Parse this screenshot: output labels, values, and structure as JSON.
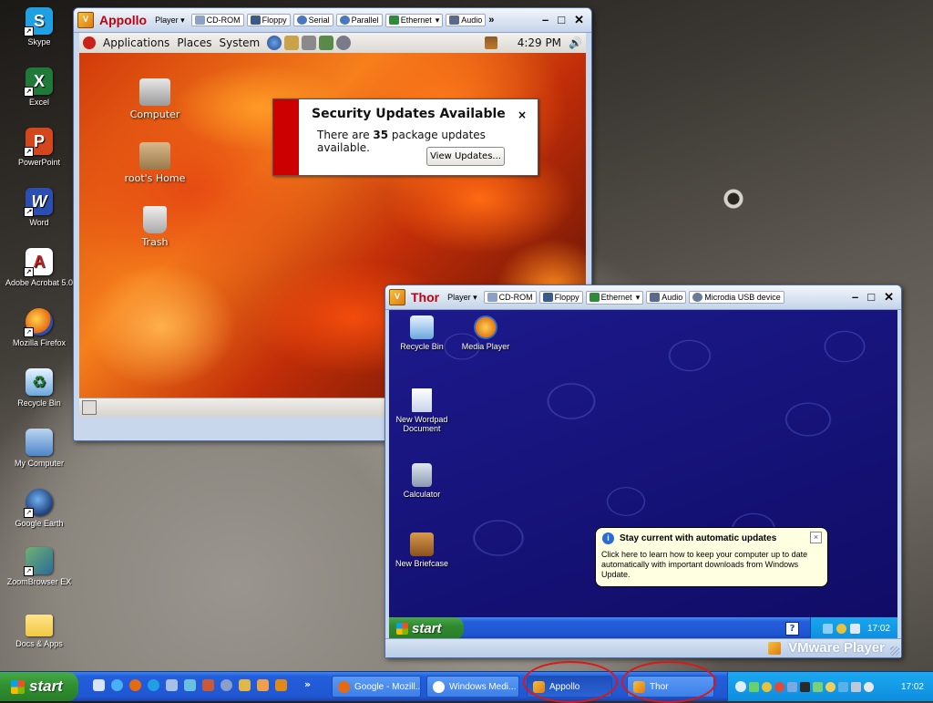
{
  "host_desktop": {
    "icons": [
      {
        "label": "Skype",
        "icon": "skype-icon",
        "color": "#1fa0e3",
        "glyph": "S"
      },
      {
        "label": "Excel",
        "icon": "excel-icon",
        "color": "#1f7a3a",
        "glyph": "X"
      },
      {
        "label": "PowerPoint",
        "icon": "powerpoint-icon",
        "color": "#d4461b",
        "glyph": "P"
      },
      {
        "label": "Word",
        "icon": "word-icon",
        "color": "#2a4fb0",
        "glyph": "W"
      },
      {
        "label": "Adobe Acrobat 5.0",
        "icon": "acrobat-icon",
        "color": "#c81f1f",
        "glyph": "A"
      },
      {
        "label": "Mozilla Firefox",
        "icon": "firefox-icon",
        "color": "#e56a12",
        "glyph": "F"
      },
      {
        "label": "Recycle Bin",
        "icon": "recycle-bin-icon",
        "color": "#5aa0d8",
        "glyph": "♻"
      },
      {
        "label": "My Computer",
        "icon": "my-computer-icon",
        "color": "#4d86c9",
        "glyph": "▣"
      },
      {
        "label": "Google Earth",
        "icon": "google-earth-icon",
        "color": "#20407a",
        "glyph": "◐"
      },
      {
        "label": "ZoomBrowser EX",
        "icon": "zoombrowser-icon",
        "color": "#3b7a3f",
        "glyph": "Z"
      },
      {
        "label": "Docs & Apps",
        "icon": "folder-icon",
        "color": "#f0c842",
        "glyph": ""
      }
    ]
  },
  "appollo": {
    "vm_name": "Appollo",
    "player_menu": "Player ▾",
    "devices": [
      "CD-ROM",
      "Floppy",
      "Serial",
      "Parallel",
      "Ethernet",
      "Audio"
    ],
    "ethernet_dropdown": "▾",
    "more": "»",
    "panel": {
      "applications": "Applications",
      "places": "Places",
      "system": "System",
      "clock": "4:29 PM"
    },
    "desktop_icons": [
      {
        "label": "Computer"
      },
      {
        "label": "root's Home"
      },
      {
        "label": "Trash"
      }
    ],
    "notification": {
      "title": "Security Updates Available",
      "close": "×",
      "body_prefix": "There are ",
      "count": "35",
      "body_suffix": " package updates available.",
      "button": "View Updates..."
    }
  },
  "thor": {
    "vm_name": "Thor",
    "player_menu": "Player ▾",
    "devices": [
      "CD-ROM",
      "Floppy",
      "Ethernet",
      "Audio",
      "Microdia USB device"
    ],
    "ethernet_dropdown": "▾",
    "desktop_icons": [
      {
        "label": "Recycle Bin"
      },
      {
        "label": "Media Player"
      },
      {
        "label": "New Wordpad Document"
      },
      {
        "label": "Calculator"
      },
      {
        "label": "New Briefcase"
      }
    ],
    "balloon": {
      "title": "Stay current with automatic updates",
      "body": "Click here to learn how to keep your computer up to date automatically with important downloads from Windows Update.",
      "close": "×"
    },
    "start": "start",
    "clock": "17:02",
    "footer_brand": "VMware Player"
  },
  "host_taskbar": {
    "start": "start",
    "more": "»",
    "buttons": [
      {
        "label": "Google - Mozill...",
        "icon": "firefox-icon"
      },
      {
        "label": "Windows Medi...",
        "icon": "media-player-icon"
      },
      {
        "label": "Appollo",
        "icon": "vmware-icon"
      },
      {
        "label": "Thor",
        "icon": "vmware-icon"
      }
    ],
    "clock": "17:02"
  },
  "colors": {
    "xp_blue": "#245edb",
    "xp_green": "#319031",
    "vm_title_red": "#c0000c",
    "notif_red": "#cc0000"
  }
}
